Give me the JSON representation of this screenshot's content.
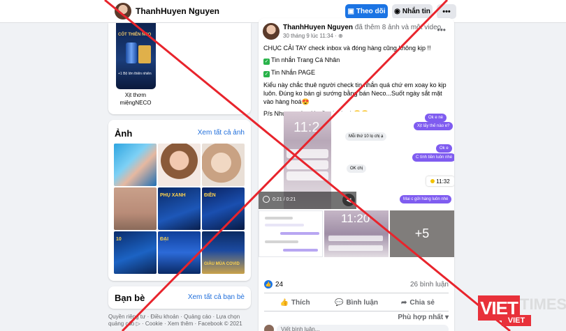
{
  "header": {
    "profile_name": "ThanhHuyen Nguyen",
    "follow_label": "Theo dõi",
    "message_label": "Nhắn tin",
    "more_label": "•••"
  },
  "sidebar": {
    "product": {
      "image_text": "CỐT THIÊN NCO",
      "image_subtext": "+1 Bộ lớn thiên nhiên",
      "label": "Xịt thơm miệngNECO"
    },
    "photos": {
      "title": "Ảnh",
      "see_all": "Xem tất cả ảnh",
      "captions": [
        "PHỤ XANH",
        "ĐIỀN",
        "",
        "10",
        "",
        "ĐẠI",
        "GIÀU MÙA COVID"
      ]
    },
    "friends": {
      "title": "Bạn bè",
      "see_all": "Xem tất cả bạn bè"
    },
    "footer": "Quyền riêng tư · Điều khoản · Quảng cáo · Lựa chọn quảng cáo ▷ · Cookie · Xem thêm · Facebook © 2021"
  },
  "post": {
    "author": "ThanhHuyen Nguyen",
    "action": "đã thêm 8 ảnh và một video.",
    "timestamp": "30 tháng 9 lúc 11:34 · ",
    "text_lines": [
      "CHỤC CẢI TAY check inbox và đóng hàng cũng không kịp !!",
      "Tin nhắn Trang Cá Nhân",
      "Tin Nhắn PAGE",
      "Kiểu này chắc thuê người check tin nhắn quá chứ em xoay ko kịp luôn. Đúng ko bán gì sướng bằng bán Neco...Suốt ngày sắt mặt vào hàng hoá😍",
      "P/s Nhưng mà e Huyền thích ạh😍😍"
    ],
    "media": {
      "video_time": "0:21 / 0:21",
      "chat_bubbles": [
        {
          "side": "me",
          "text": "Ok e nè"
        },
        {
          "side": "me",
          "text": "Xịt lấy thế nào e?"
        },
        {
          "side": "them",
          "text": "Mỗi thứ 10 lọ chị ạ"
        },
        {
          "side": "me",
          "text": "Ok e"
        },
        {
          "side": "me",
          "text": "C tính tiền luôn nhé"
        },
        {
          "side": "them",
          "text": "OK chị"
        },
        {
          "side": "me",
          "text": "Mai c gửi hàng luôn nhé"
        }
      ],
      "clock_time": "11:32",
      "phone_clock": "11:2",
      "phone_clock_2": "11:20",
      "more_count": "+5"
    },
    "likes": "24",
    "comments": "26 bình luận",
    "like_label": "Thích",
    "comment_label": "Bình luận",
    "share_label": "Chia sẻ",
    "sort_label": "Phù hợp nhất ▾",
    "comment_placeholder": "Viết bình luận..."
  },
  "watermark": {
    "brand": "VIET",
    "brand_suffix": "TIMES",
    "badge": "VIET"
  },
  "colors": {
    "accent": "#1b74e4",
    "cross": "#e8242c",
    "watermark": "#e8313a"
  }
}
